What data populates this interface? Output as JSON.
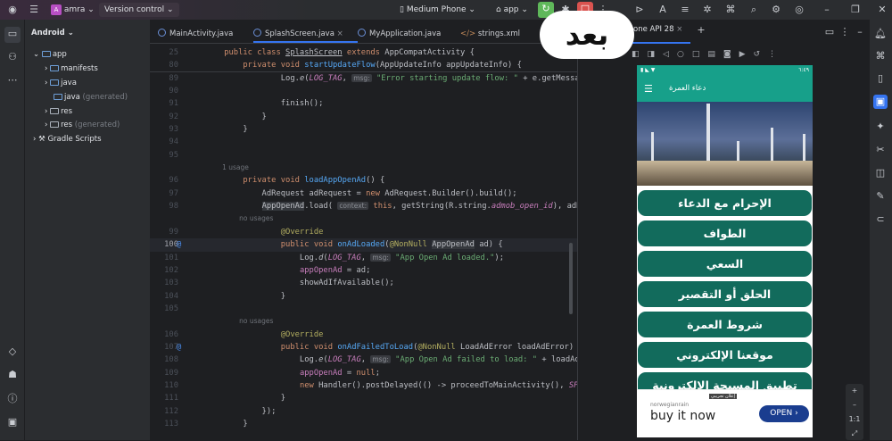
{
  "topbar": {
    "project": "amra",
    "project_initial": "A",
    "vcs": "Version control",
    "device": "Medium Phone",
    "run_config": "app"
  },
  "project_panel": {
    "view": "Android",
    "tree": [
      {
        "label": "app",
        "extra": ""
      },
      {
        "label": "manifests",
        "extra": ""
      },
      {
        "label": "java",
        "extra": ""
      },
      {
        "label": "java",
        "extra": "(generated)"
      },
      {
        "label": "res",
        "extra": ""
      },
      {
        "label": "res",
        "extra": "(generated)"
      },
      {
        "label": "Gradle Scripts",
        "extra": ""
      }
    ]
  },
  "editor_tabs": [
    {
      "label": "MainActivity.java"
    },
    {
      "label": "SplashScreen.java",
      "active": true
    },
    {
      "label": "MyApplication.java"
    },
    {
      "label": "strings.xml"
    }
  ],
  "code": [
    {
      "n": "25",
      "sticky": true,
      "t": [
        [
          "",
          "    "
        ],
        [
          "k",
          "public class "
        ],
        [
          "u",
          "SplashScreen"
        ],
        [
          "k",
          " extends "
        ],
        [
          "",
          "AppCompatActivity {"
        ]
      ]
    },
    {
      "n": "80",
      "sticky": true,
      "t": [
        [
          "",
          "        "
        ],
        [
          "k",
          "private void "
        ],
        [
          "f",
          "startUpdateFlow"
        ],
        [
          "",
          "(AppUpdateInfo appUpdateInfo) {"
        ]
      ]
    },
    {
      "n": "89",
      "t": [
        [
          "",
          "                Log."
        ],
        [
          "m",
          "e"
        ],
        [
          "",
          "("
        ],
        [
          "i",
          "LOG_TAG"
        ],
        [
          "",
          ", "
        ],
        [
          "h",
          "msg:"
        ],
        [
          "s",
          " \"Error starting update flow: \""
        ],
        [
          "",
          " + e.getMessage()"
        ]
      ]
    },
    {
      "n": "90",
      "t": []
    },
    {
      "n": "91",
      "t": [
        [
          "",
          "                finish();"
        ]
      ]
    },
    {
      "n": "92",
      "t": [
        [
          "",
          "            }"
        ]
      ]
    },
    {
      "n": "93",
      "t": [
        [
          "",
          "        }"
        ]
      ]
    },
    {
      "n": "94",
      "t": []
    },
    {
      "n": "95",
      "t": []
    },
    {
      "n": "",
      "hint": true,
      "t": [
        [
          "",
          "        1 usage"
        ]
      ]
    },
    {
      "n": "96",
      "t": [
        [
          "",
          "        "
        ],
        [
          "k",
          "private void "
        ],
        [
          "f",
          "loadAppOpenAd"
        ],
        [
          "",
          "() {"
        ]
      ]
    },
    {
      "n": "97",
      "t": [
        [
          "",
          "            AdRequest adRequest = "
        ],
        [
          "k",
          "new "
        ],
        [
          "",
          "AdRequest.Builder().build();"
        ]
      ]
    },
    {
      "n": "98",
      "t": [
        [
          "",
          "            "
        ],
        [
          "b",
          "AppOpenAd"
        ],
        [
          "",
          ".load( "
        ],
        [
          "h",
          "context:"
        ],
        [
          "k",
          " this"
        ],
        [
          "",
          ", getString(R.string."
        ],
        [
          "i",
          "admob_open_id"
        ],
        [
          "",
          "), adRequest"
        ]
      ]
    },
    {
      "n": "",
      "hint": true,
      "t": [
        [
          "",
          "                no usages"
        ]
      ]
    },
    {
      "n": "99",
      "t": [
        [
          "",
          "                "
        ],
        [
          "a",
          "@Override"
        ]
      ]
    },
    {
      "n": "100",
      "cur": true,
      "t": [
        [
          "",
          "                "
        ],
        [
          "k",
          "public void "
        ],
        [
          "f",
          "onAdLoaded"
        ],
        [
          "",
          "("
        ],
        [
          "a",
          "@NonNull "
        ],
        [
          "b",
          "AppOpenAd"
        ],
        [
          "",
          " ad) {"
        ]
      ]
    },
    {
      "n": "101",
      "t": [
        [
          "",
          "                    Log."
        ],
        [
          "m",
          "d"
        ],
        [
          "",
          "("
        ],
        [
          "i",
          "LOG_TAG"
        ],
        [
          "",
          ", "
        ],
        [
          "h",
          "msg:"
        ],
        [
          "s",
          " \"App Open Ad loaded.\""
        ],
        [
          "",
          ");"
        ]
      ]
    },
    {
      "n": "102",
      "t": [
        [
          "",
          "                    "
        ],
        [
          "v",
          "appOpenAd"
        ],
        [
          "",
          " = ad;"
        ]
      ]
    },
    {
      "n": "103",
      "t": [
        [
          "",
          "                    showAdIfAvailable();"
        ]
      ]
    },
    {
      "n": "104",
      "t": [
        [
          "",
          "                }"
        ]
      ]
    },
    {
      "n": "105",
      "t": []
    },
    {
      "n": "",
      "hint": true,
      "t": [
        [
          "",
          "                no usages"
        ]
      ]
    },
    {
      "n": "106",
      "t": [
        [
          "",
          "                "
        ],
        [
          "a",
          "@Override"
        ]
      ]
    },
    {
      "n": "107",
      "t": [
        [
          "",
          "                "
        ],
        [
          "k",
          "public void "
        ],
        [
          "f",
          "onAdFailedToLoad"
        ],
        [
          "",
          "("
        ],
        [
          "a",
          "@NonNull "
        ],
        [
          "",
          "LoadAdError loadAdError) {"
        ]
      ]
    },
    {
      "n": "108",
      "t": [
        [
          "",
          "                    Log."
        ],
        [
          "m",
          "e"
        ],
        [
          "",
          "("
        ],
        [
          "i",
          "LOG_TAG"
        ],
        [
          "",
          ", "
        ],
        [
          "h",
          "msg:"
        ],
        [
          "s",
          " \"App Open Ad failed to load: \""
        ],
        [
          "",
          " + loadAdError"
        ]
      ]
    },
    {
      "n": "109",
      "t": [
        [
          "",
          "                    "
        ],
        [
          "v",
          "appOpenAd"
        ],
        [
          "",
          " = "
        ],
        [
          "k",
          "null"
        ],
        [
          "",
          ";"
        ]
      ]
    },
    {
      "n": "110",
      "t": [
        [
          "",
          "                    "
        ],
        [
          "k",
          "new "
        ],
        [
          "",
          "Handler().postDelayed(() -> proceedToMainActivity(), "
        ],
        [
          "i",
          "SPLASH_"
        ]
      ]
    },
    {
      "n": "111",
      "t": [
        [
          "",
          "                }"
        ]
      ]
    },
    {
      "n": "112",
      "t": [
        [
          "",
          "            });"
        ]
      ]
    },
    {
      "n": "113",
      "t": [
        [
          "",
          "        }"
        ]
      ]
    }
  ],
  "emulator": {
    "tab": "one API 28",
    "status_time": "٦:٤٩",
    "app_title": "دعاء العمرة",
    "buttons": [
      "الإحرام مع الدعاء",
      "الطواف",
      "السعي",
      "الحلق أو التقصير",
      "شروط العمرة",
      "موقعنا الإلكتروني",
      "تطبيق المسبحة الإلكترونية"
    ],
    "ad": {
      "badge": "إعلان تجريبي",
      "advertiser": "norwegianrain",
      "headline": "buy it now",
      "cta": "OPEN"
    },
    "zoom_label": "1:1"
  },
  "overlay": {
    "text": "بعد"
  },
  "colors": {
    "teal": "#17a08a",
    "button": "#126b5c",
    "accent": "#3574f0"
  }
}
